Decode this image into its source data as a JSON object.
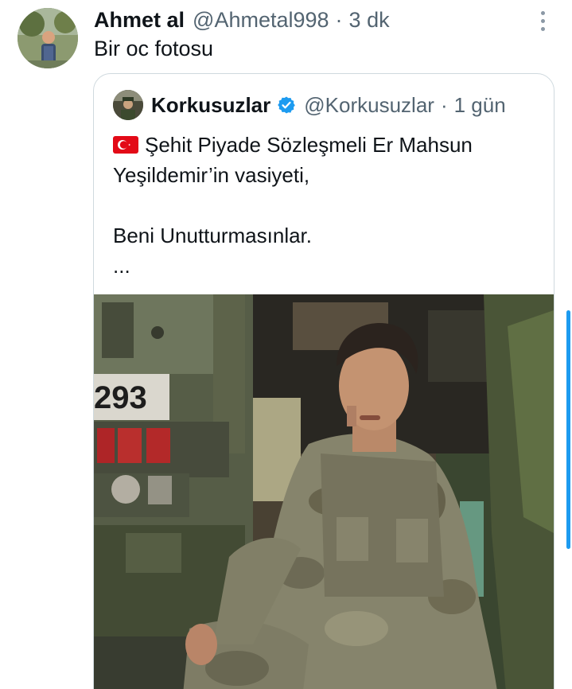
{
  "tweet": {
    "author_name": "Ahmet al",
    "author_handle": "@Ahmetal998",
    "separator": "·",
    "time": "3 dk",
    "text": "Bir oc fotosu",
    "avatar_icon": "user-avatar-photo",
    "more_icon": "more-vertical-icon"
  },
  "quote": {
    "author_name": "Korkusuzlar",
    "author_handle": "@Korkusuzlar",
    "separator": "·",
    "time": "1 gün",
    "verified_icon": "verified-badge-icon",
    "line1": "Şehit Piyade Sözleşmeli Er Mahsun",
    "line2": "Yeşildemir’in vasiyeti,",
    "line3": "Beni Unutturmasınlar.",
    "line4": "...",
    "flag_icon": "turkey-flag-icon",
    "media": {
      "vehicle_number": "293",
      "description_icon": "soldier-photo"
    }
  },
  "colors": {
    "text": "#0f1419",
    "secondary": "#536471",
    "border": "#cfd9de",
    "accent": "#1d9bf0"
  }
}
